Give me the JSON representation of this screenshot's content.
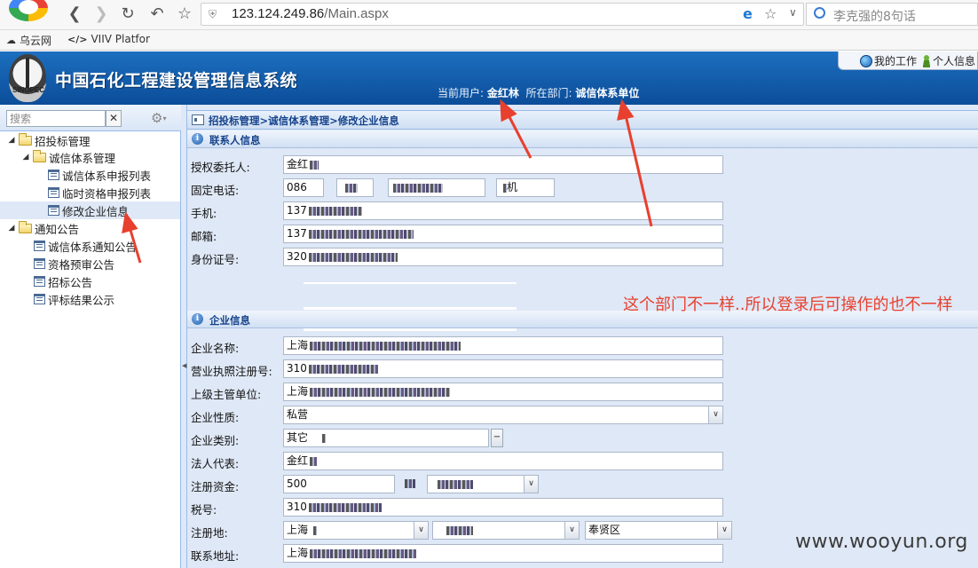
{
  "browser": {
    "url_host": "123.124.249.86",
    "url_path": "/Main.aspx",
    "search_placeholder": "李克强的8句话",
    "bookmarks": [
      {
        "label": "乌云网"
      },
      {
        "label": "VIIV Platfor",
        "icon": "</>"
      }
    ]
  },
  "header": {
    "title": "中国石化工程建设管理信息系统",
    "logo_text": "SINOPEC",
    "current_user_label": "当前用户:",
    "current_user": "金红林",
    "department_label": "所在部门:",
    "department": "诚信体系单位",
    "my_work": "我的工作",
    "personal_info": "个人信息"
  },
  "sidebar": {
    "search_placeholder": "搜索",
    "clear": "✕",
    "tree": [
      {
        "label": "招投标管理",
        "level": 0,
        "type": "folder"
      },
      {
        "label": "诚信体系管理",
        "level": 1,
        "type": "folder"
      },
      {
        "label": "诚信体系申报列表",
        "level": 2,
        "type": "doc"
      },
      {
        "label": "临时资格申报列表",
        "level": 2,
        "type": "doc"
      },
      {
        "label": "修改企业信息",
        "level": 2,
        "type": "doc",
        "selected": true
      },
      {
        "label": "通知公告",
        "level": 0,
        "type": "folder"
      },
      {
        "label": "诚信体系通知公告",
        "level": 1,
        "type": "doc"
      },
      {
        "label": "资格预审公告",
        "level": 1,
        "type": "doc"
      },
      {
        "label": "招标公告",
        "level": 1,
        "type": "doc"
      },
      {
        "label": "评标结果公示",
        "level": 1,
        "type": "doc"
      }
    ]
  },
  "main": {
    "breadcrumb": "招投标管理>诚信体系管理>修改企业信息",
    "contact_section": "联系人信息",
    "company_section": "企业信息",
    "contact_fields": {
      "authorized_label": "授权委托人:",
      "authorized_value": "金红",
      "phone_label": "固定电话:",
      "phone_value": "086",
      "phone_ext": "机",
      "mobile_label": "手机:",
      "mobile_value": "137",
      "email_label": "邮箱:",
      "email_value": "137",
      "id_label": "身份证号:",
      "id_value": "320"
    },
    "company_fields": {
      "name_label": "企业名称:",
      "name_value": "上海",
      "license_label": "营业执照注册号:",
      "license_value": "310",
      "parent_label": "上级主管单位:",
      "parent_value": "上海",
      "nature_label": "企业性质:",
      "nature_value": "私营",
      "category_label": "企业类别:",
      "category_value": "其它",
      "legal_label": "法人代表:",
      "legal_value": "金红",
      "capital_label": "注册资金:",
      "capital_value": "500",
      "tax_label": "税号:",
      "tax_value": "310",
      "reg_label": "注册地:",
      "reg_province": "上海",
      "reg_district": "奉贤区",
      "address_label": "联系地址:",
      "address_value": "上海"
    }
  },
  "annotation": "这个部门不一样..所以登录后可操作的也不一样",
  "watermark": "www.wooyun.org",
  "colors": {
    "header_blue": "#0b4d99",
    "panel_blue": "#dfe8f6",
    "annotation_red": "#e8402e"
  }
}
